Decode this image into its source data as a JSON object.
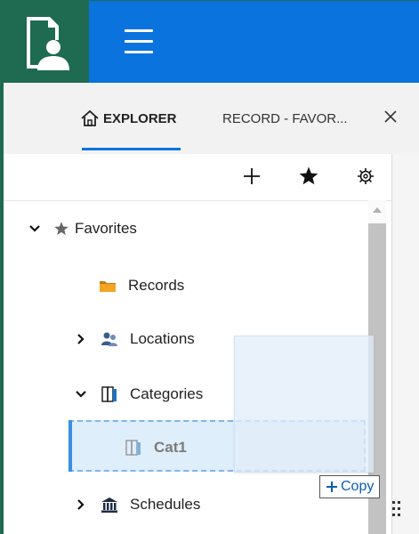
{
  "header": {
    "logo_icon": "records-user-logo-icon",
    "menu_icon": "hamburger-menu-icon",
    "brand_color": "#0a73de",
    "logo_bg": "#1e6b52"
  },
  "tabs": [
    {
      "label": "EXPLORER",
      "icon": "home-icon",
      "active": true
    },
    {
      "label": "RECORD - FAVOR...",
      "active": false
    }
  ],
  "toolbar": {
    "buttons": [
      {
        "name": "add",
        "icon": "plus-icon"
      },
      {
        "name": "favorite",
        "icon": "star-icon"
      },
      {
        "name": "settings",
        "icon": "gear-icon"
      }
    ]
  },
  "tree": {
    "favorites": {
      "label": "Favorites",
      "icon": "star-icon",
      "expanded": true
    },
    "records": {
      "label": "Records",
      "icon": "folder-icon"
    },
    "locations": {
      "label": "Locations",
      "icon": "locations-icon",
      "expanded": false
    },
    "categories": {
      "label": "Categories",
      "icon": "categories-icon",
      "expanded": true
    },
    "cat1": {
      "label": "Cat1",
      "icon": "categories-icon"
    },
    "schedules": {
      "label": "Schedules",
      "icon": "building-icon",
      "expanded": false
    }
  },
  "drag": {
    "badge_label": "Copy"
  }
}
